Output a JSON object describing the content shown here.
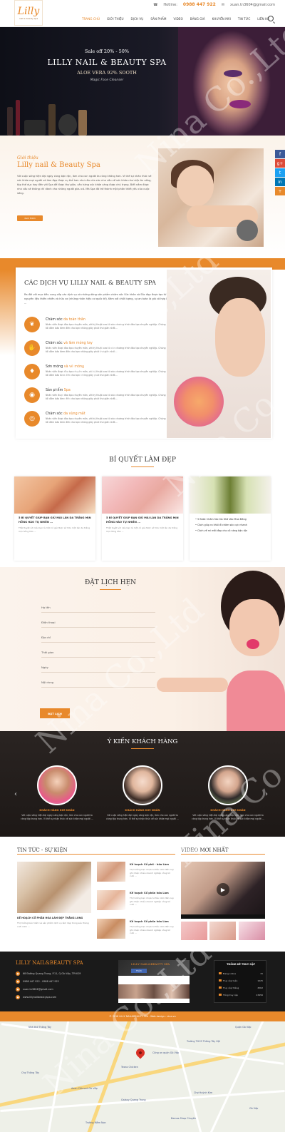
{
  "header": {
    "logo_text": "Lilly",
    "logo_sub": "nail & beauty spa",
    "hotline_label": "Hotline:",
    "hotline": "0988 447 922",
    "email": "xuan.tn3604@gmail.com",
    "nav": [
      "TRANG CHỦ",
      "GIỚI THIỆU",
      "DỊCH VỤ",
      "SẢN PHẨM",
      "VIDEO",
      "BẢNG GIÁ",
      "KHUYẾN MÃI",
      "TIN TỨC",
      "LIÊN HỆ"
    ]
  },
  "hero": {
    "sale": "Sale off 20% - 50%",
    "title": "LILLY NAIL & BEAUTY SPA",
    "subtitle": "ALOE VERA 92% SOOTH",
    "magic": "Magic Face Cleanser"
  },
  "about": {
    "script": "Giới thiệu",
    "title": "Lilly nail & Beauty Spa",
    "text": "Với cuộc sống hiện đại ngày càng bận rộn, làm cho con người ta cũng không hơn. Vì thế sự nhân thức về sức khỏe mọi người và làm đẹp được cụ thể hơn như cầu của các như cầu về sức khỏe như việc ăn uống, tập thể dục hay đến với Spa để được thư giãn, cần hàng sức khỏe càng được chú trọng. Biết nắm được như cầu sẽ không chỉ dành cho những người giàu có. Mà Spa đã trở thành một phần thiết yếu của cuộc sống.",
    "button": "Xem thêm"
  },
  "social": [
    "f",
    "g+",
    "t",
    "in",
    "+"
  ],
  "services": {
    "title": "CÁC DỊCH VỤ LILLY NAIL & BEAUTY SPA",
    "intro": "Ra đời với mục tiêu cung cấp các dịch vụ và những dòng sản phẩm chăm sóc Sức khỏe và Sắc đẹp được tạo từ những nguyên liệu thiên nhiên và hữu cơ (những nhãn hiệu cơ quốc tế). Kèm với chất lượng, sự an toàn là giá cả hợp lý nhất ...",
    "items": [
      {
        "prefix": "Chăm sóc",
        "name": "da toàn thân",
        "icon": "leaf"
      },
      {
        "prefix": "Chăm sóc",
        "name": "và làm móng tay",
        "icon": "hand"
      },
      {
        "prefix": "Sơn móng",
        "name": "và vẽ móng",
        "icon": "polish"
      },
      {
        "prefix": "Sản phẩm",
        "name": "Spa",
        "icon": "jar"
      },
      {
        "prefix": "Chăm sóc",
        "name": "da vùng mắt",
        "icon": "eye"
      }
    ],
    "item_desc": "Nhân viên được đào tạo chuyên môn, với kỹ thuật cao từ các chương trình đào tạo chuyên nghiệp. Chúng tôi đảm bảo đem đến cho bạn những giây phút thư giãn nhất..."
  },
  "tips": {
    "title": "BÍ QUYẾT LÀM ĐẸP",
    "items": [
      {
        "title": "5 BÍ QUYẾT GIÚP BẠN GIỮ MÀI LÀN DA TRẮNG MỊN HỒNG HÀO TỰ NHIÊN ...",
        "desc": "Thật tuyệt vời nếu bạn là một cô gái được sở hữu một làn da trắng mịn hồng hào ..."
      },
      {
        "title": "5 BÍ QUYẾT GIÚP BẠN GIỮ MÀI LÀN DA TRẮNG MỊN HỒNG HÀO TỰ NHIÊN ...",
        "desc": "Thật tuyệt vời nếu bạn là một cô gái được sở hữu một làn da trắng mịn hồng hào ..."
      }
    ],
    "list": [
      "5 Bước Chăm Sóc Da Khô Vào Mùa Đông",
      "Cách giúp ra khỏi đi chăm sóc cực nhanh",
      "Cách về mi mắt đẹp cho cô nàng bận rộn"
    ]
  },
  "booking": {
    "title": "ĐẶT LỊCH HẸN",
    "fields": [
      "Họ tên",
      "Điện thoại",
      "Địa chỉ",
      "Thời gian",
      "Ngày",
      "Nội dung"
    ],
    "button": "ĐẶT LỊCH"
  },
  "testimonials": {
    "title": "Ý KIẾN KHÁCH HÀNG",
    "items": [
      {
        "name": "KHÁCH HÀNG KIM NGÂN",
        "text": "Với cuộc sống hiện đại ngày càng bận rộn, làm cho con người ta càng tập trung hơn. Vì thế sự nhận thức về sức khỏe mọi người ..."
      },
      {
        "name": "KHÁCH HÀNG KIM NGÂN",
        "text": "Với cuộc sống hiện đại ngày càng bận rộn, làm cho con người ta càng tập trung hơn. Vì thế sự nhận thức về sức khỏe mọi người ..."
      },
      {
        "name": "KHÁCH HÀNG KIM NGÂN",
        "text": "Với cuộc sống hiện đại ngày càng bận rộn, làm cho con người ta càng tập trung hơn. Vì thế sự nhận thức về sức khỏe mọi người ..."
      }
    ]
  },
  "news": {
    "title": "TIN TỨC - SỰ KIỆN",
    "main_title": "KẾ HOẠCH CỔ PHẦN HÓA LÀM ĐẸP THẲNG LONG",
    "main_desc": "Thị trường bảo hiểm và sản phẩm dịch vụ làm đẹp trong sáu tháng cuối năm ...",
    "items": [
      {
        "title": "Kế hoạch Cổ phầ - hóa Làm",
        "desc": "Thị trường bạn nhựa tư đầu năm đến nay ghi nhận nhiều doanh nghiệp công bố cuối ..."
      },
      {
        "title": "Kế hoạch Cổ phần hóa Làm",
        "desc": "Thị trường bạn nhựa tư đầu năm đến nay ghi nhận nhiều doanh nghiệp công bố cuối ..."
      },
      {
        "title": "Kế hoạch Cổ phần hóa Làm",
        "desc": "Thị trường bạn nhựa tư đầu năm đến nay ghi nhận nhiều doanh nghiệp công bố cuối ..."
      }
    ]
  },
  "video": {
    "title": "VIDEO MỚI NHẤT"
  },
  "footer": {
    "brand": "LILLY NAIL&BEAUTY SPA",
    "address": "68 Đường Quang Trung, P.11, Q.Gò Vấp, TP.HCM",
    "phone": "0988 447 922 - 0988 447 922",
    "email": "xuan.tn3604@gmail.com",
    "website": "www.lillynailbeautyspa.com",
    "fb_name": "LILLY NAIL&BEAUTY SPA",
    "fb_like": "Thích",
    "stats_title": "THỐNG KÊ TRUY CẬP",
    "stats": [
      {
        "label": "Đang online",
        "value": "15"
      },
      {
        "label": "Truy cập tuần",
        "value": "1025"
      },
      {
        "label": "Truy cập tháng",
        "value": "4562"
      },
      {
        "label": "Tổng truy cập",
        "value": "23456"
      }
    ],
    "copyright": "© 2018 LILLY NAIL&BEAUTY SPA . Web design : nina.vn"
  },
  "map": {
    "labels": [
      "Nhà thờ Thông Tây",
      "Công an quận Gò Vấp",
      "Trường THCS Thông Tây Hội",
      "Texas Chicken",
      "Aeon Citimart Gò Vấp",
      "Galaxy Quang Trung",
      "Chợ Huỳnh Kim",
      "Bamos Shop Chuyên",
      "Chợ Thông Tây",
      "Quận Gò Vấp",
      "Trường Mầm Non",
      "Gò Vấp"
    ]
  },
  "watermark": "Nina Co.,Ltd"
}
